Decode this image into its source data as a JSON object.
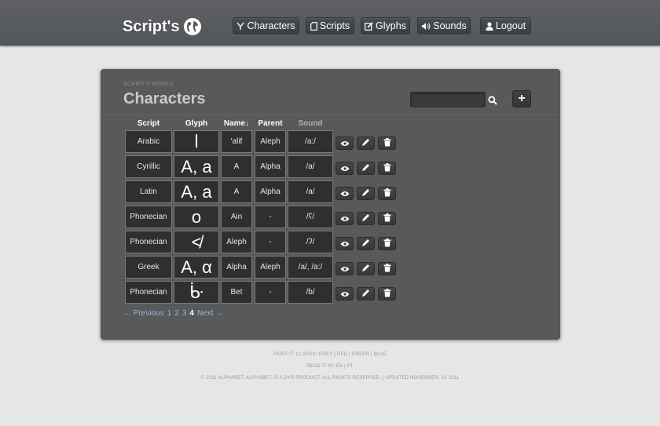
{
  "brand": {
    "name": "Script's"
  },
  "nav": [
    {
      "label": "Characters",
      "icon": "characters-icon"
    },
    {
      "label": "Scripts",
      "icon": "scripts-icon"
    },
    {
      "label": "Glyphs",
      "icon": "glyphs-icon"
    },
    {
      "label": "Sounds",
      "icon": "sound-icon"
    },
    {
      "label": "Logout",
      "icon": "user-icon"
    }
  ],
  "panel": {
    "kicker": "SCRIPT'S WORLD",
    "title": "Characters",
    "search_value": "",
    "add_label": "+"
  },
  "table": {
    "headers": {
      "script": "Script",
      "glyph": "Glyph",
      "name": "Name",
      "name_sort": "↓",
      "parent": "Parent",
      "sound": "Sound Value"
    },
    "rows": [
      {
        "script": "Arabic",
        "glyph": "ا",
        "name": "'alif",
        "parent": "Aleph",
        "sound": "/a:/"
      },
      {
        "script": "Cyrillic",
        "glyph": "A, a",
        "name": "A",
        "parent": "Alpha",
        "sound": "/a/"
      },
      {
        "script": "Latin",
        "glyph": "A, a",
        "name": "A",
        "parent": "Alpha",
        "sound": "/a/"
      },
      {
        "script": "Phonecian",
        "glyph": "o",
        "name": "Ain",
        "parent": "-",
        "sound": "/ʕ/"
      },
      {
        "script": "Phonecian",
        "glyph": "≮",
        "name": "Aleph",
        "parent": "-",
        "sound": "/ʔ/"
      },
      {
        "script": "Greek",
        "glyph": "Α, α",
        "name": "Alpha",
        "parent": "Aleph",
        "sound": "/a/, /a:/"
      },
      {
        "script": "Phonecian",
        "glyph": "ᒁ",
        "name": "Bet",
        "parent": "-",
        "sound": "/b/"
      }
    ]
  },
  "pager": {
    "prev": "← Previous",
    "pages": [
      "1",
      "2",
      "3",
      "4"
    ],
    "current": "4",
    "next": "Next →"
  },
  "footer": {
    "line1_prefix": "PAINT IT:",
    "themes": [
      "CLASSIC GREY",
      "RED",
      "GREEN",
      "BLUE"
    ],
    "line2_prefix": "READ IT IN:",
    "languages": [
      "EN",
      "PT"
    ],
    "copyright": "© 2011 ALPHABET. ALPHABET IS A DYR PRODUCT. ALL RIGHTS RESERVED. | UPDATED NOVEMBER, 10 2011"
  },
  "colors": {
    "topbar": "#58595b",
    "panel": "#58595b",
    "cell": "#2e2f31",
    "background": "#e6e6e6",
    "link": "#9db4c9"
  }
}
